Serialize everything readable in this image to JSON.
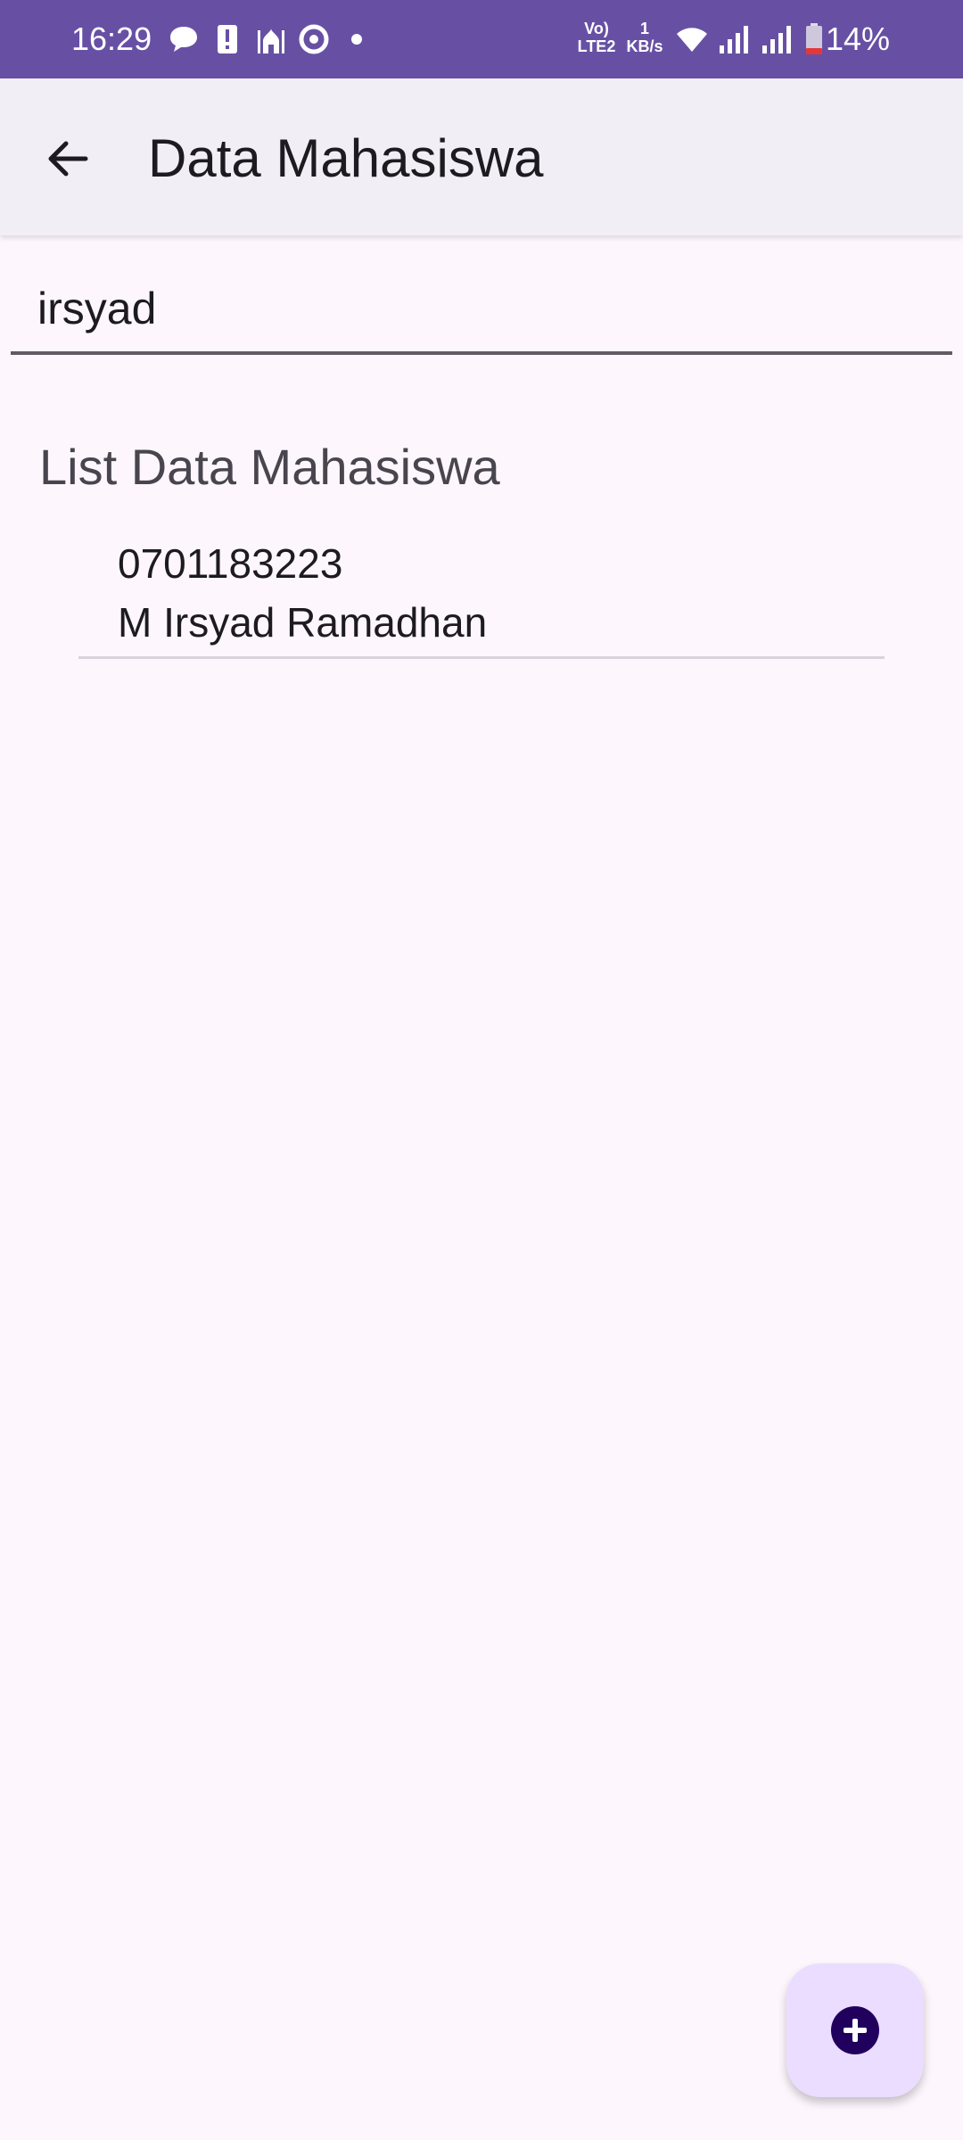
{
  "status_bar": {
    "time": "16:29",
    "net_top": "Vo)",
    "net_bottom": "LTE2",
    "speed_top": "1",
    "speed_bottom": "KB/s",
    "battery": "14%",
    "icons": [
      "chat-bubble-icon",
      "alert-icon",
      "mosque-icon",
      "location-icon",
      "dot-icon",
      "wifi-icon",
      "signal-icon",
      "signal-icon",
      "battery-icon"
    ]
  },
  "app_bar": {
    "title": "Data Mahasiswa",
    "back_icon": "arrow-left-icon"
  },
  "search": {
    "value": "irsyad"
  },
  "list": {
    "title": "List Data Mahasiswa",
    "items": [
      {
        "nim": "0701183223",
        "name": "M Irsyad Ramadhan"
      }
    ]
  },
  "fab": {
    "icon": "add-circle-icon"
  },
  "colors": {
    "status_bar": "#6750a4",
    "app_bar": "#f2eef6",
    "background": "#fdf7fd",
    "fab": "#eaddff",
    "fab_icon": "#21005d"
  }
}
